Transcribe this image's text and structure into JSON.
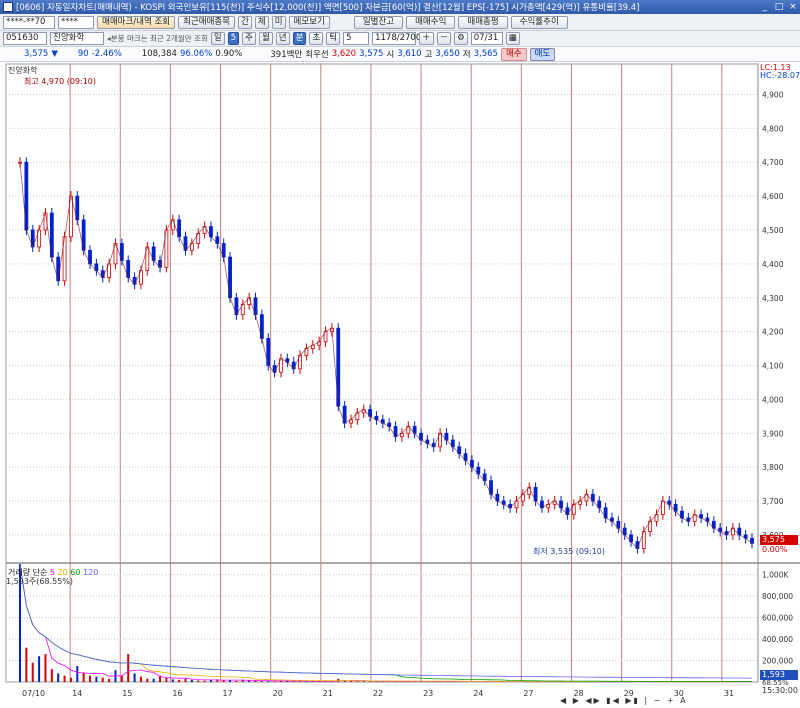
{
  "window": {
    "title": "[0606] 자동일자차트(매매내역) - KOSPI 외국인보유[115(천)] 주식수[12,000(천)] 액면[500] 자본금[60(억)] 결산[12월] EPS[-175] 시가총액[429(억)] 유통비율[39.4]",
    "minimize": "_",
    "maximize": "□",
    "close": "×"
  },
  "toolbar1": {
    "account": "****-**70",
    "password": "****",
    "trade_history_btn": "매매마크/내역 조회",
    "recent_trades_btn": "최근매매종목",
    "btn_gan": "간",
    "btn_che": "체",
    "btn_mi": "미",
    "memo_btn": "메모보기",
    "daily_balance_btn": "일별잔고",
    "trade_profit_btn": "매매수익",
    "trade_summary_btn": "매매총평",
    "profit_trend_btn": "수익률추이"
  },
  "toolbar2": {
    "code": "051630",
    "name": "진양화학",
    "notice": "◂분봉 마크는 최근 2개월만 조회",
    "period_day": "일",
    "period_5": "5",
    "period_min": "주",
    "period_month": "월",
    "period_year": "년",
    "period_bun": "분",
    "period_cho": "초",
    "period_tick": "틱",
    "interval": "5",
    "count": "1178/2700",
    "date": "07/31"
  },
  "quote": {
    "price": "3,575",
    "arrow": "▼",
    "change": "90",
    "change_pct": "-2.46%",
    "volume": "108,384",
    "vol_ratio": "96.06%",
    "vol_ratio2": "0.90%",
    "amount": "391백만",
    "bid_label": "최우선",
    "bid": "3,620",
    "ask": "3,575",
    "open_label": "시",
    "open": "3,610",
    "high_label": "고",
    "high": "3,650",
    "low_label": "저",
    "low": "3,565",
    "buy_btn": "매수",
    "sell_btn": "매도"
  },
  "chart_labels": {
    "stock_name": "진양화학",
    "high_marker": "최고 4,970 (09:10)",
    "low_marker": "최저 3,535 (09:10)",
    "lc": "LC:1.13",
    "hc": "HC:-28.07",
    "last_price": "3,575",
    "last_pct": "0.00%",
    "vol_title": "거래량",
    "vol_ma_label": "단순",
    "vol_ma5": "5",
    "vol_ma20": "20",
    "vol_ma60": "60",
    "vol_ma120": "120",
    "vol_value": "1,593주(68.55%)",
    "vol_last": "1,593",
    "vol_pct": "68.55%",
    "time_label": "15:30:00"
  },
  "colors": {
    "up": "#d40000",
    "down": "#0022cc",
    "day_line": "#c88080",
    "grid": "#c9c9c9",
    "ma5": "#ff00ff",
    "ma20": "#e8b400",
    "ma60": "#00a000",
    "ma120": "#6060ff"
  },
  "chart_data": {
    "type": "line",
    "series": [
      {
        "name": "진양화학",
        "values": [
          4700,
          4500,
          4450,
          4500,
          4550,
          4420,
          4350,
          4480,
          4600,
          4530,
          4440,
          4400,
          4380,
          4360,
          4400,
          4460,
          4410,
          4360,
          4340,
          4380,
          4450,
          4410,
          4390,
          4500,
          4530,
          4480,
          4440,
          4460,
          4490,
          4510,
          4480,
          4460,
          4420,
          4300,
          4250,
          4280,
          4300,
          4250,
          4180,
          4100,
          4080,
          4120,
          4110,
          4090,
          4130,
          4150,
          4160,
          4170,
          4200,
          4210,
          3980,
          3930,
          3940,
          3960,
          3970,
          3950,
          3940,
          3930,
          3920,
          3890,
          3900,
          3920,
          3900,
          3880,
          3870,
          3860,
          3900,
          3880,
          3860,
          3840,
          3820,
          3800,
          3780,
          3760,
          3720,
          3700,
          3690,
          3680,
          3700,
          3720,
          3740,
          3700,
          3680,
          3690,
          3700,
          3680,
          3660,
          3690,
          3700,
          3720,
          3700,
          3680,
          3650,
          3640,
          3620,
          3600,
          3580,
          3560,
          3610,
          3640,
          3660,
          3700,
          3690,
          3670,
          3650,
          3640,
          3660,
          3650,
          3640,
          3620,
          3610,
          3600,
          3620,
          3600,
          3590,
          3575
        ]
      }
    ],
    "x_ticks": [
      "07/10",
      "14",
      "15",
      "16",
      "17",
      "20",
      "21",
      "22",
      "23",
      "24",
      "27",
      "28",
      "29",
      "30",
      "31"
    ],
    "y_ticks": [
      4900,
      4800,
      4700,
      4600,
      4500,
      4400,
      4300,
      4200,
      4100,
      4000,
      3900,
      3800,
      3700,
      3600
    ],
    "ylim": [
      3520,
      4990
    ],
    "volume": {
      "y_ticks": [
        "1,000K",
        "800,000",
        "600,000",
        "400,000",
        "200,000"
      ],
      "ylim": [
        0,
        1100000
      ],
      "values": [
        1100000,
        320000,
        180000,
        240000,
        260000,
        120000,
        80000,
        60000,
        40000,
        150000,
        90000,
        60000,
        50000,
        40000,
        30000,
        110000,
        60000,
        260000,
        80000,
        50000,
        30000,
        30000,
        60000,
        40000,
        25000,
        20000,
        30000,
        20000,
        15000,
        12000,
        20000,
        25000,
        18000,
        14000,
        10000,
        22000,
        15000,
        12000,
        9000,
        8000,
        8000,
        12000,
        10000,
        9000,
        7000,
        6000,
        9000,
        8000,
        7000,
        6000,
        30000,
        15000,
        10000,
        9000,
        8000,
        7000,
        6000,
        7000,
        8000,
        6000,
        5000,
        6000,
        7000,
        5000,
        5000,
        4000,
        6000,
        5000,
        4000,
        4000,
        5000,
        6000,
        5000,
        4000,
        4000,
        4000,
        5000,
        4000,
        4000,
        3000,
        5000,
        4000,
        3000,
        3000,
        3000,
        4000,
        3000,
        3000,
        4000,
        3000,
        3000,
        3000,
        3000,
        4000,
        3000,
        3000,
        3000,
        4000,
        3000,
        3000,
        4000,
        3000,
        3000,
        2000,
        3000,
        3000,
        2000,
        3000,
        3000,
        2000,
        3000,
        2000,
        2000,
        3000,
        2000,
        1593
      ]
    },
    "grid": true
  }
}
